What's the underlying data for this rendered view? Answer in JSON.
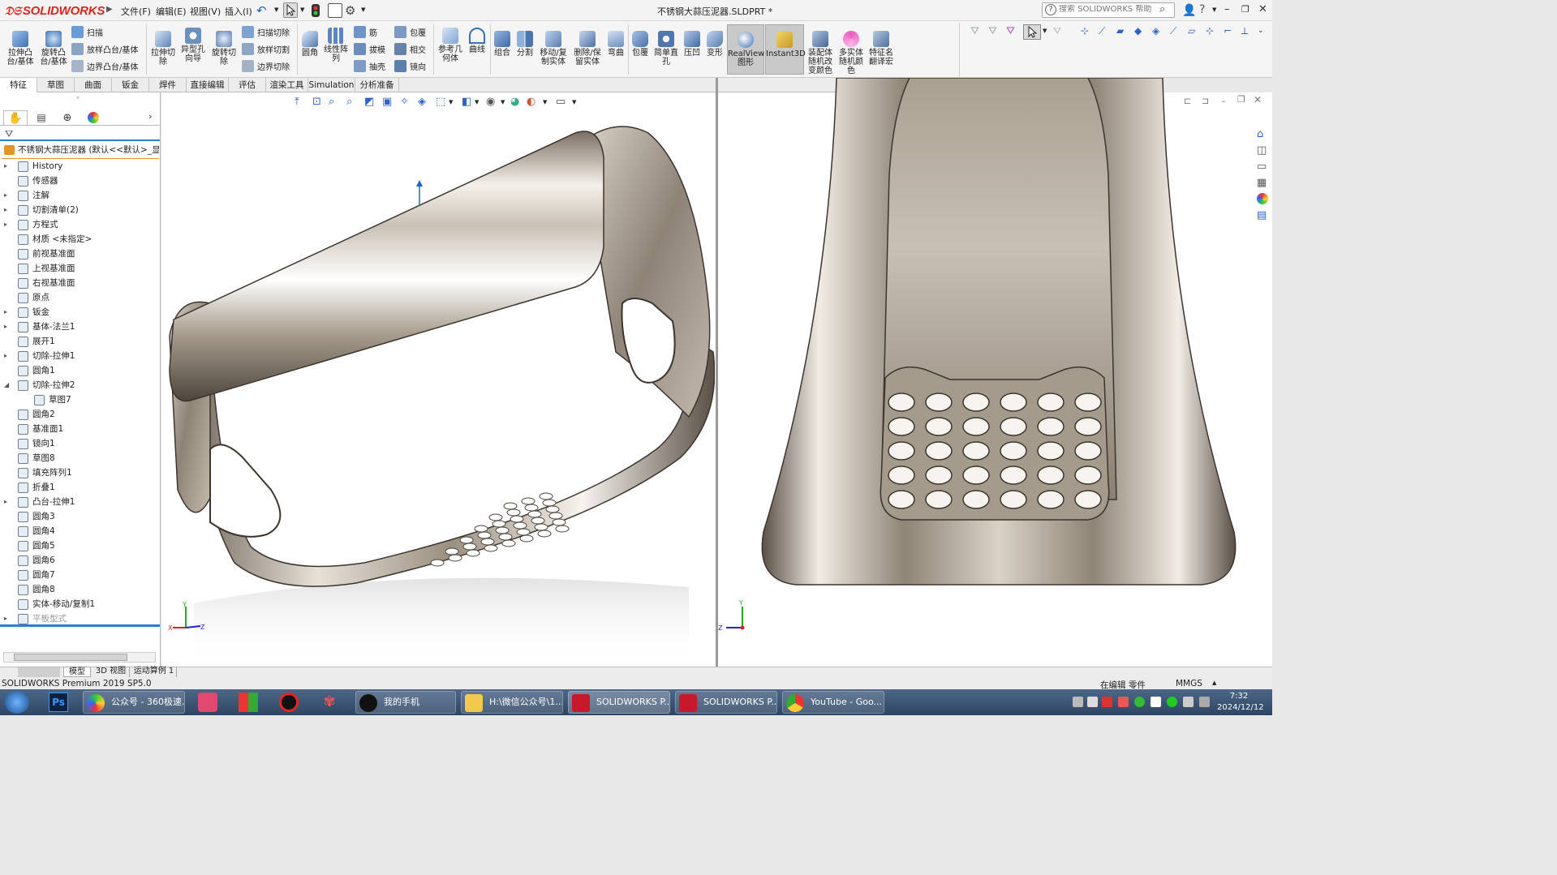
{
  "app": {
    "brand": "SOLIDWORKS",
    "document_title": "不锈钢大蒜压泥器.SLDPRT *",
    "help_search_placeholder": "搜索 SOLIDWORKS 帮助"
  },
  "menu": [
    "文件(F)",
    "编辑(E)",
    "视图(V)",
    "插入(I)"
  ],
  "ribbon": {
    "large_buttons": [
      {
        "label": "拉伸凸\n台/基体"
      },
      {
        "label": "旋转凸\n台/基体"
      },
      {
        "label": "拉伸切\n除"
      },
      {
        "label": "异型孔\n向导"
      },
      {
        "label": "旋转切\n除"
      },
      {
        "label": "圆角"
      },
      {
        "label": "线性阵\n列"
      },
      {
        "label": "参考几\n何体"
      },
      {
        "label": "曲线"
      },
      {
        "label": "组合"
      },
      {
        "label": "分割"
      },
      {
        "label": "移动/复\n制实体"
      },
      {
        "label": "删除/保\n留实体"
      },
      {
        "label": "弯曲"
      },
      {
        "label": "包覆"
      },
      {
        "label": "简单直\n孔"
      },
      {
        "label": "压凹"
      },
      {
        "label": "变形"
      },
      {
        "label": "RealView\n图形"
      },
      {
        "label": "Instant3D"
      },
      {
        "label": "装配体\n随机改\n变颜色"
      },
      {
        "label": "多实体\n随机颜\n色"
      },
      {
        "label": "特征名\n翻译宏"
      }
    ],
    "small_buttons": [
      {
        "label": "扫描"
      },
      {
        "label": "放样凸台/基体"
      },
      {
        "label": "边界凸台/基体"
      },
      {
        "label": "扫描切除"
      },
      {
        "label": "放样切割"
      },
      {
        "label": "边界切除"
      },
      {
        "label": "筋"
      },
      {
        "label": "拔模"
      },
      {
        "label": "抽壳"
      },
      {
        "label": "包覆"
      },
      {
        "label": "相交"
      },
      {
        "label": "镜向"
      }
    ]
  },
  "command_tabs": [
    "特征",
    "草图",
    "曲面",
    "钣金",
    "焊件",
    "直接编辑",
    "评估",
    "渲染工具",
    "Simulation",
    "分析准备"
  ],
  "feature_tree": {
    "root": "不锈钢大蒜压泥器 (默认<<默认>_显示",
    "items": [
      {
        "label": "History",
        "expandable": true
      },
      {
        "label": "传感器",
        "expandable": false
      },
      {
        "label": "注解",
        "expandable": true
      },
      {
        "label": "切割清单(2)",
        "expandable": true
      },
      {
        "label": "方程式",
        "expandable": true
      },
      {
        "label": "材质 <未指定>",
        "expandable": false
      },
      {
        "label": "前视基准面",
        "expandable": false
      },
      {
        "label": "上视基准面",
        "expandable": false
      },
      {
        "label": "右视基准面",
        "expandable": false
      },
      {
        "label": "原点",
        "expandable": false
      },
      {
        "label": "钣金",
        "expandable": true
      },
      {
        "label": "基体-法兰1",
        "expandable": true
      },
      {
        "label": "展开1",
        "expandable": false
      },
      {
        "label": "切除-拉伸1",
        "expandable": true
      },
      {
        "label": "圆角1",
        "expandable": false
      },
      {
        "label": "切除-拉伸2",
        "expandable": true,
        "expanded": true
      },
      {
        "label": "草图7",
        "expandable": false,
        "child": true
      },
      {
        "label": "圆角2",
        "expandable": false
      },
      {
        "label": "基准面1",
        "expandable": false
      },
      {
        "label": "镜向1",
        "expandable": false
      },
      {
        "label": "草图8",
        "expandable": false
      },
      {
        "label": "填充阵列1",
        "expandable": false
      },
      {
        "label": "折叠1",
        "expandable": false
      },
      {
        "label": "凸台-拉伸1",
        "expandable": true
      },
      {
        "label": "圆角3",
        "expandable": false
      },
      {
        "label": "圆角4",
        "expandable": false
      },
      {
        "label": "圆角5",
        "expandable": false
      },
      {
        "label": "圆角6",
        "expandable": false
      },
      {
        "label": "圆角7",
        "expandable": false
      },
      {
        "label": "圆角8",
        "expandable": false
      },
      {
        "label": "实体-移动/复制1",
        "expandable": false
      },
      {
        "label": "平板型式",
        "expandable": true,
        "suppressed": true
      }
    ]
  },
  "bottom_tabs": [
    "模型",
    "3D 视图",
    "运动算例 1"
  ],
  "status": {
    "version": "SOLIDWORKS Premium 2019 SP5.0",
    "mode": "在编辑 零件",
    "units": "MMGS"
  },
  "taskbar": {
    "items": [
      {
        "label": "公众号 - 360极速..."
      },
      {
        "label": "我的手机"
      },
      {
        "label": "H:\\微信公众号\\1..."
      },
      {
        "label": "SOLIDWORKS P..."
      },
      {
        "label": "SOLIDWORKS P..."
      },
      {
        "label": "YouTube - Goo..."
      }
    ],
    "time": "7:32",
    "date": "2024/12/12"
  },
  "colors": {
    "brand_red": "#d9261c",
    "tree_accent": "#e69524",
    "selection_blue": "#1e62d0"
  }
}
